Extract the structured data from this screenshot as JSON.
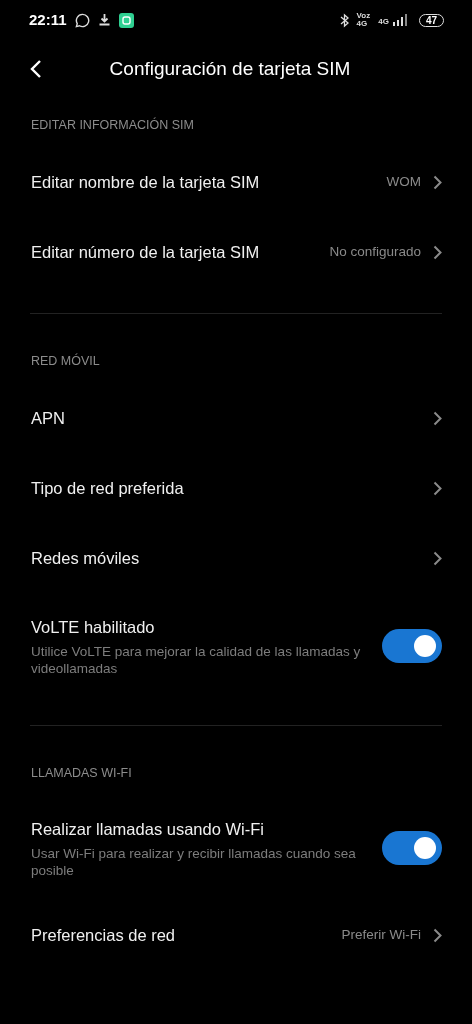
{
  "status_bar": {
    "time": "22:11",
    "network_label_top": "Voz",
    "network_label_bottom": "4G",
    "signal_label": "4G",
    "battery": "47"
  },
  "header": {
    "title": "Configuración de tarjeta SIM"
  },
  "sections": [
    {
      "title": "EDITAR INFORMACIÓN SIM",
      "items": [
        {
          "kind": "nav",
          "label": "Editar nombre de la tarjeta SIM",
          "value": "WOM"
        },
        {
          "kind": "nav",
          "label": "Editar número de la tarjeta SIM",
          "value": "No configurado"
        }
      ]
    },
    {
      "title": "RED MÓVIL",
      "items": [
        {
          "kind": "nav",
          "label": "APN"
        },
        {
          "kind": "nav",
          "label": "Tipo de red preferida"
        },
        {
          "kind": "nav",
          "label": "Redes móviles"
        },
        {
          "kind": "toggle",
          "label": "VoLTE habilitado",
          "description": "Utilice VoLTE para mejorar la calidad de las llamadas y videollamadas",
          "on": true
        }
      ]
    },
    {
      "title": "LLAMADAS WI-FI",
      "items": [
        {
          "kind": "toggle",
          "label": "Realizar llamadas usando Wi-Fi",
          "description": "Usar Wi-Fi para realizar y recibir llamadas cuando sea posible",
          "on": true
        },
        {
          "kind": "nav",
          "label": "Preferencias de red",
          "value": "Preferir Wi-Fi"
        }
      ]
    }
  ]
}
